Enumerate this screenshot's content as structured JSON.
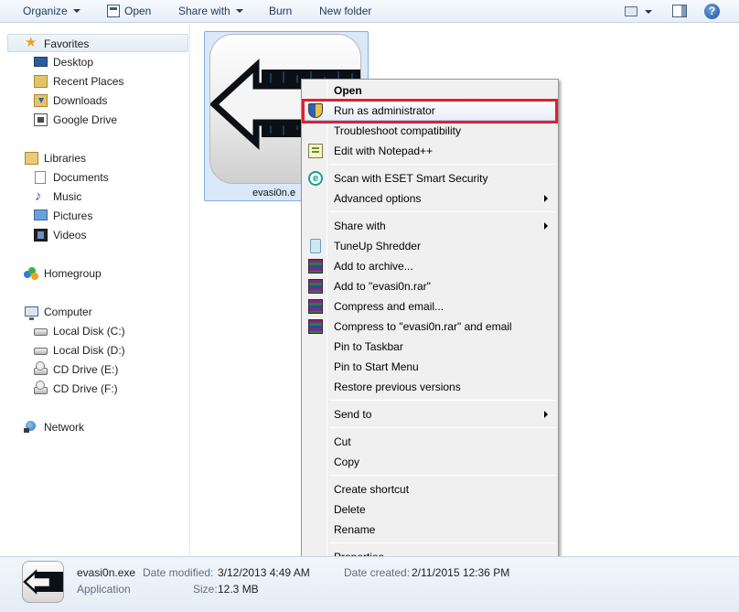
{
  "toolbar": {
    "organize": "Organize",
    "open": "Open",
    "share_with": "Share with",
    "burn": "Burn",
    "new_folder": "New folder"
  },
  "nav": {
    "favorites": "Favorites",
    "desktop": "Desktop",
    "recent_places": "Recent Places",
    "downloads": "Downloads",
    "google_drive": "Google Drive",
    "libraries": "Libraries",
    "documents": "Documents",
    "music": "Music",
    "pictures": "Pictures",
    "videos": "Videos",
    "homegroup": "Homegroup",
    "computer": "Computer",
    "local_c": "Local Disk (C:)",
    "local_d": "Local Disk (D:)",
    "cd_e": "CD Drive (E:)",
    "cd_f": "CD Drive (F:)",
    "network": "Network"
  },
  "file": {
    "name_truncated": "evasi0n.e"
  },
  "context_menu": {
    "open": "Open",
    "run_as_admin": "Run as administrator",
    "troubleshoot": "Troubleshoot compatibility",
    "edit_notepad": "Edit with Notepad++",
    "scan_eset": "Scan with ESET Smart Security",
    "advanced": "Advanced options",
    "share_with": "Share with",
    "tuneup": "TuneUp Shredder",
    "add_archive": "Add to archive...",
    "add_rar": "Add to \"evasi0n.rar\"",
    "compress_email": "Compress and email...",
    "compress_rar_email": "Compress to \"evasi0n.rar\" and email",
    "pin_taskbar": "Pin to Taskbar",
    "pin_start": "Pin to Start Menu",
    "restore": "Restore previous versions",
    "send_to": "Send to",
    "cut": "Cut",
    "copy": "Copy",
    "create_shortcut": "Create shortcut",
    "delete": "Delete",
    "rename": "Rename",
    "properties": "Properties"
  },
  "status": {
    "file_name": "evasi0n.exe",
    "type": "Application",
    "date_modified_label": "Date modified:",
    "date_modified_value": "3/12/2013 4:49 AM",
    "size_label": "Size:",
    "size_value": "12.3 MB",
    "date_created_label": "Date created:",
    "date_created_value": "2/11/2015 12:36 PM"
  },
  "colors": {
    "highlight_box": "#e0202e",
    "selection": "#d9e9fb"
  }
}
